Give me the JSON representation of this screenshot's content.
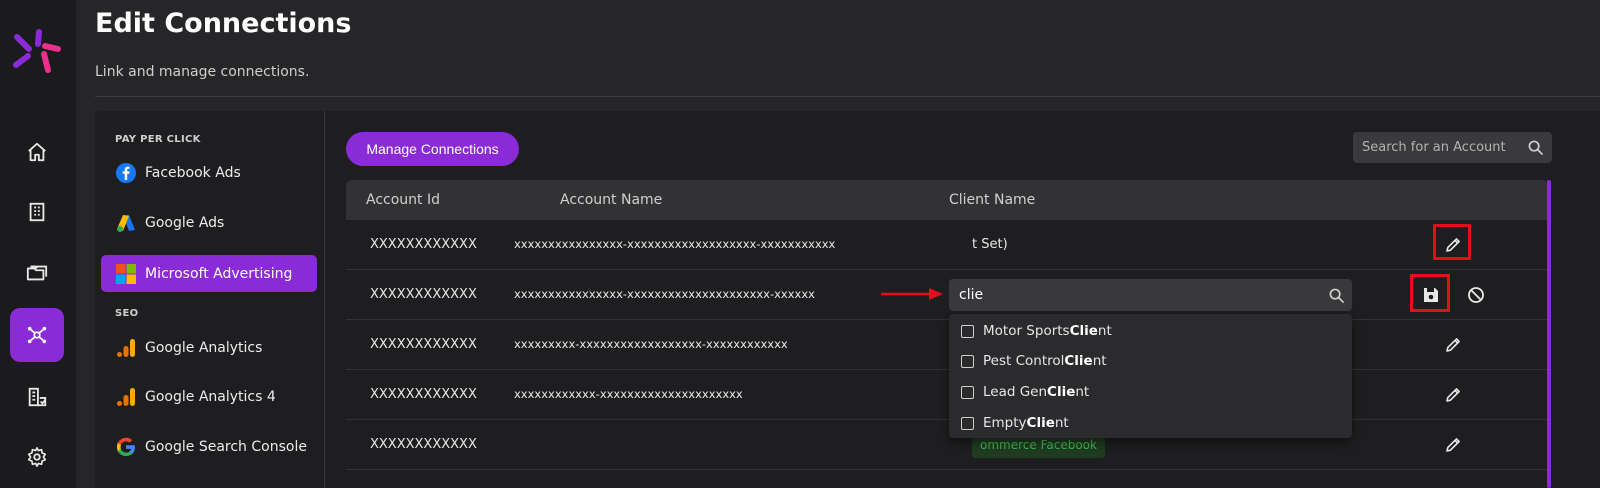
{
  "header": {
    "title": "Edit Connections",
    "subtitle": "Link and manage connections."
  },
  "nav_rail": {
    "items": [
      {
        "icon": "home-icon"
      },
      {
        "icon": "building-icon"
      },
      {
        "icon": "folder-icon"
      },
      {
        "icon": "connections-icon",
        "active": true
      },
      {
        "icon": "reports-icon"
      },
      {
        "icon": "gear-icon"
      }
    ]
  },
  "sidebar": {
    "sections": [
      {
        "title": "PAY PER CLICK",
        "items": [
          {
            "label": "Facebook Ads",
            "icon": "facebook-icon"
          },
          {
            "label": "Google Ads",
            "icon": "google-ads-icon"
          },
          {
            "label": "Microsoft Advertising",
            "icon": "microsoft-icon",
            "active": true
          }
        ]
      },
      {
        "title": "SEO",
        "items": [
          {
            "label": "Google Analytics",
            "icon": "google-analytics-icon"
          },
          {
            "label": "Google Analytics 4",
            "icon": "google-analytics-icon"
          },
          {
            "label": "Google Search Console",
            "icon": "google-icon"
          }
        ]
      }
    ]
  },
  "toolbar": {
    "manage_label": "Manage Connections",
    "search_placeholder": "Search for an Account"
  },
  "table": {
    "columns": [
      "Account Id",
      "Account Name",
      "Client Name"
    ],
    "rows": [
      {
        "id": "XXXXXXXXXXXX",
        "name": "xxxxxxxxxxxxxxxx-xxxxxxxxxxxxxxxxxxx-xxxxxxxxxxx",
        "client": "t Set)",
        "action": "edit"
      },
      {
        "id": "XXXXXXXXXXXX",
        "name": "xxxxxxxxxxxxxxxx-xxxxxxxxxxxxxxxxxxxxx-xxxxxx",
        "client": "",
        "action": "save-cancel"
      },
      {
        "id": "XXXXXXXXXXXX",
        "name": "xxxxxxxxx-xxxxxxxxxxxxxxxxxx-xxxxxxxxxxxx",
        "client": "",
        "action": "edit"
      },
      {
        "id": "XXXXXXXXXXXX",
        "name": "xxxxxxxxxxxx-xxxxxxxxxxxxxxxxxxxxx",
        "client": "",
        "action": "edit"
      },
      {
        "id": "XXXXXXXXXXXX",
        "name": "",
        "client_badge": "ommerce Facebook",
        "action": "edit"
      }
    ]
  },
  "client_search": {
    "value": "clie",
    "options": [
      {
        "prefix": "Motor Sports ",
        "match": "Clie",
        "suffix": "nt"
      },
      {
        "prefix": "Pest Control ",
        "match": "Clie",
        "suffix": "nt"
      },
      {
        "prefix": "Lead Gen ",
        "match": "Clie",
        "suffix": "nt"
      }
    ],
    "last_option": {
      "prefix": "Empty ",
      "match": "Clie",
      "suffix": "nt"
    }
  },
  "colors": {
    "accent": "#8b2ad7",
    "highlight": "#e3101c",
    "badge_text": "#3fb44e"
  }
}
